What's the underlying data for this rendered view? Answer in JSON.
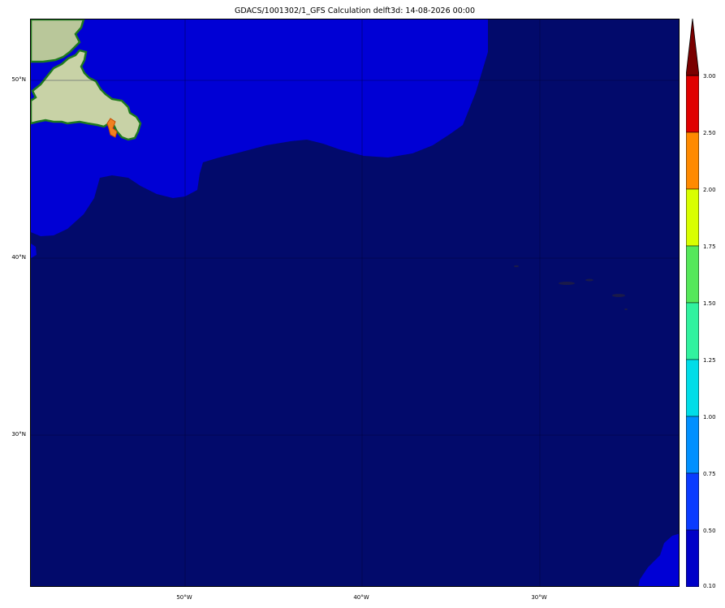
{
  "title": "GDACS/1001302/1_GFS Calculation delft3d: 14-08-2026 00:00",
  "map": {
    "lat_labels": [
      "50°N",
      "40°N",
      "30°N"
    ],
    "lon_labels": [
      "50°W",
      "40°W",
      "30°W"
    ],
    "colors": {
      "ocean_deep": "#020a6b",
      "ocean_shelf": "#0000d5",
      "land": "#b9c79a",
      "coast": "#1f7a1f",
      "surge_hotspot": "#f08020"
    }
  },
  "colorbar": {
    "labels": [
      "3.00",
      "2.50",
      "2.00",
      "1.75",
      "1.50",
      "1.25",
      "1.00",
      "0.75",
      "0.50",
      "0.10"
    ],
    "colors": [
      "#e00000",
      "#ff8a00",
      "#d9ff00",
      "#55e85a",
      "#31f29f",
      "#00dde8",
      "#0090ff",
      "#0a3bff",
      "#0000c8"
    ],
    "extend_color": "#7a0000"
  }
}
